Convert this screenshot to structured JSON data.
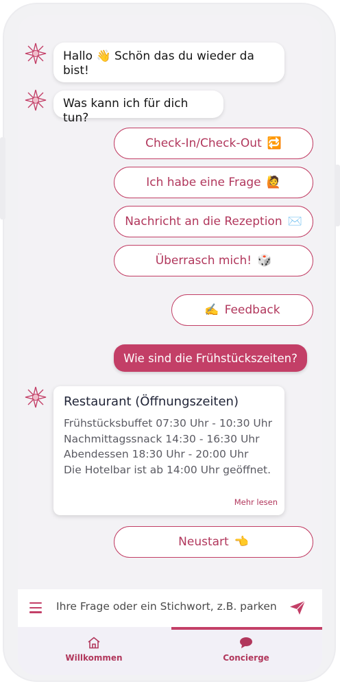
{
  "chat": {
    "greeting": "Hallo 👋 Schön das du wieder da bist!",
    "question": "Was kann ich für dich tun?",
    "options": [
      {
        "label": "Check-In/Check-Out",
        "emoji": "🔁"
      },
      {
        "label": "Ich habe eine Frage",
        "emoji": "🙋"
      },
      {
        "label": "Nachricht an die Rezeption",
        "emoji": "✉️"
      },
      {
        "label": "Überrasch mich!",
        "emoji": "🎲"
      }
    ],
    "feedback": {
      "emoji": "✍️",
      "label": "Feedback"
    },
    "user_message": "Wie sind die Frühstückszeiten?",
    "card": {
      "title": "Restaurant (Öffnungszeiten)",
      "lines": [
        "Frühstücksbuffet 07:30 Uhr - 10:30 Uhr",
        "Nachmittagssnack 14:30 - 16:30 Uhr",
        "Abendessen 18:30 Uhr - 20:00 Uhr",
        "Die Hotelbar ist ab 14:00 Uhr geöffnet."
      ],
      "more": "Mehr lesen"
    },
    "restart": {
      "label": "Neustart",
      "emoji": "👈"
    }
  },
  "input": {
    "placeholder": "Ihre Frage oder ein Stichwort, z.B. parken",
    "menu_icon": "hamburger-menu-icon",
    "send_icon": "send-icon"
  },
  "tabs": [
    {
      "label": "Willkommen",
      "icon": "home-icon",
      "active": false
    },
    {
      "label": "Concierge",
      "icon": "chat-bubble-icon",
      "active": true
    }
  ],
  "colors": {
    "accent": "#c33f67",
    "accent_text": "#b1375c",
    "background": "#f3f2f5",
    "tabbar": "#f2f0f7"
  }
}
